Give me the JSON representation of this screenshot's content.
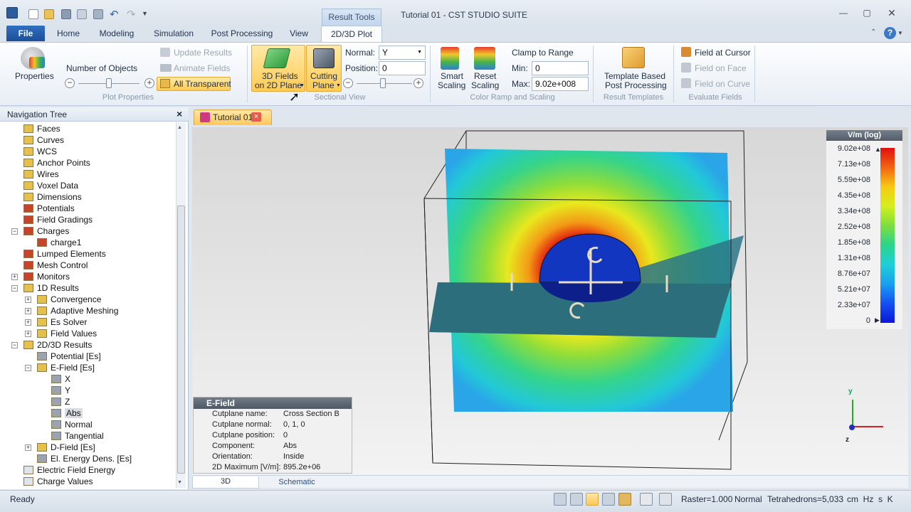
{
  "window": {
    "title": "Tutorial 01 - CST STUDIO SUITE",
    "context_tab": "Result Tools"
  },
  "ribbon_tabs": [
    "File",
    "Home",
    "Modeling",
    "Simulation",
    "Post Processing",
    "View",
    "2D/3D Plot"
  ],
  "ribbon": {
    "properties": "Properties",
    "num_objects": "Number of Objects",
    "update_results": "Update Results",
    "animate_fields": "Animate Fields",
    "all_transparent": "All Transparent",
    "group_plot_properties": "Plot Properties",
    "fields_2d_line1": "3D Fields",
    "fields_2d_line2": "on 2D Plane",
    "cutting_line1": "Cutting",
    "cutting_line2": "Plane",
    "normal_label": "Normal:",
    "normal_value": "Y",
    "position_label": "Position:",
    "position_value": "0",
    "group_sectional_view": "Sectional View",
    "smart_line1": "Smart",
    "smart_line2": "Scaling",
    "reset_line1": "Reset",
    "reset_line2": "Scaling",
    "clamp": "Clamp to Range",
    "min_label": "Min:",
    "min_value": "0",
    "max_label": "Max:",
    "max_value": "9.02e+008",
    "group_color_ramp": "Color Ramp and Scaling",
    "template_line1": "Template Based",
    "template_line2": "Post Processing",
    "group_result_templates": "Result Templates",
    "field_cursor": "Field at Cursor",
    "field_face": "Field on Face",
    "field_curve": "Field on Curve",
    "group_evaluate": "Evaluate Fields"
  },
  "nav": {
    "title": "Navigation Tree",
    "items": [
      "Faces",
      "Curves",
      "WCS",
      "Anchor Points",
      "Wires",
      "Voxel Data",
      "Dimensions",
      "Potentials",
      "Field Gradings",
      "Charges",
      "charge1",
      "Lumped Elements",
      "Mesh Control",
      "Monitors",
      "1D Results",
      "Convergence",
      "Adaptive Meshing",
      "Es Solver",
      "Field Values",
      "2D/3D Results",
      "Potential [Es]",
      "E-Field [Es]",
      "X",
      "Y",
      "Z",
      "Abs",
      "Normal",
      "Tangential",
      "D-Field [Es]",
      "El. Energy Dens. [Es]",
      "Electric Field Energy",
      "Charge Values"
    ]
  },
  "doc_tab": "Tutorial 01",
  "info": {
    "title": "E-Field",
    "rows": [
      {
        "k": "Cutplane name:",
        "v": "Cross Section B"
      },
      {
        "k": "Cutplane normal:",
        "v": "0, 1, 0"
      },
      {
        "k": "Cutplane position:",
        "v": "0"
      },
      {
        "k": "Component:",
        "v": "Abs"
      },
      {
        "k": "Orientation:",
        "v": "Inside"
      },
      {
        "k": "2D Maximum [V/m]:",
        "v": "895.2e+06"
      }
    ]
  },
  "legend": {
    "title": "V/m (log)",
    "ticks": [
      "9.02e+08",
      "7.13e+08",
      "5.59e+08",
      "4.35e+08",
      "3.34e+08",
      "2.52e+08",
      "1.85e+08",
      "1.31e+08",
      "8.76e+07",
      "5.21e+07",
      "2.33e+07",
      "0"
    ]
  },
  "axes": {
    "y": "y",
    "z": "z"
  },
  "view_tabs": [
    "3D",
    "Schematic"
  ],
  "status": {
    "ready": "Ready",
    "raster": "Raster=1.000",
    "mode": "Normal",
    "tetra": "Tetrahedrons=5,033",
    "units": "cm  Hz  s  K"
  }
}
